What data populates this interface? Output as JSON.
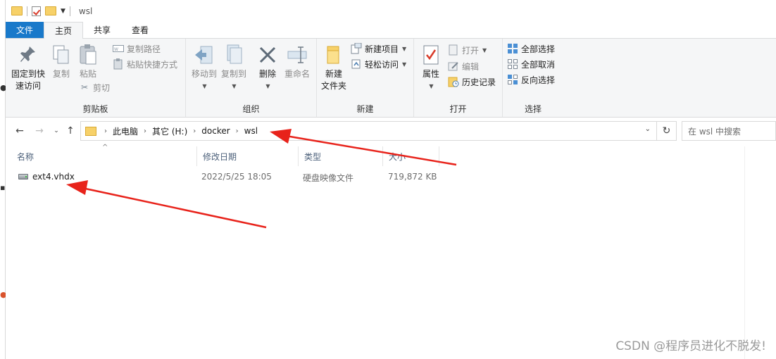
{
  "window": {
    "title": "wsl"
  },
  "tabs": [
    {
      "label": "文件"
    },
    {
      "label": "主页"
    },
    {
      "label": "共享"
    },
    {
      "label": "查看"
    }
  ],
  "ribbon": {
    "clipboard": {
      "group_label": "剪贴板",
      "pin_label_1": "固定到快",
      "pin_label_2": "速访问",
      "copy_label": "复制",
      "paste_label": "粘贴",
      "copy_path_label": "复制路径",
      "paste_shortcut_label": "粘贴快捷方式",
      "cut_label": "剪切"
    },
    "organize": {
      "group_label": "组织",
      "move_to_label": "移动到",
      "copy_to_label": "复制到",
      "delete_label": "删除",
      "rename_label": "重命名"
    },
    "new": {
      "group_label": "新建",
      "new_folder_label_1": "新建",
      "new_folder_label_2": "文件夹",
      "new_item_label": "新建项目",
      "easy_access_label": "轻松访问"
    },
    "open": {
      "group_label": "打开",
      "properties_label": "属性",
      "open_label": "打开",
      "edit_label": "编辑",
      "history_label": "历史记录"
    },
    "select": {
      "group_label": "选择",
      "select_all_label": "全部选择",
      "select_none_label": "全部取消",
      "invert_label": "反向选择"
    }
  },
  "address": {
    "crumbs": [
      "此电脑",
      "其它 (H:)",
      "docker",
      "wsl"
    ],
    "search_placeholder": "在 wsl 中搜索"
  },
  "columns": {
    "name": "名称",
    "modified": "修改日期",
    "type": "类型",
    "size": "大小"
  },
  "files": [
    {
      "name": "ext4.vhdx",
      "modified": "2022/5/25 18:05",
      "type": "硬盘映像文件",
      "size": "719,872 KB"
    }
  ],
  "watermark": "CSDN @程序员进化不脱发!",
  "colors": {
    "file_tab": "#1979ca",
    "ribbon_bg": "#f5f6f7",
    "annotation_arrow": "#e8231b"
  }
}
